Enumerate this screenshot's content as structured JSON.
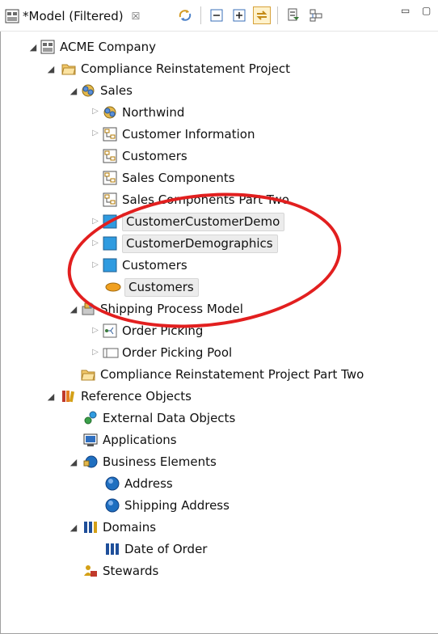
{
  "tab": {
    "title": "*Model (Filtered)",
    "close_glyph": "☒"
  },
  "toolbar": {
    "icons": [
      "sync-icon",
      "collapse-all-icon",
      "expand-all-icon",
      "link-with-editor-icon",
      "filter-icon",
      "layout-icon",
      "minimize-icon",
      "maximize-icon"
    ],
    "min_glyph": "▭",
    "max_glyph": "▢"
  },
  "tree": {
    "root": "ACME Company",
    "project1": "Compliance Reinstatement Project",
    "sales": "Sales",
    "northwind": "Northwind",
    "customer_information": "Customer Information",
    "customers_1": "Customers",
    "sales_components": "Sales Components",
    "sales_components_part_two": "Sales Components Part Two",
    "customer_customer_demo": "CustomerCustomerDemo",
    "customer_demographics": "CustomerDemographics",
    "customers_2": "Customers",
    "customers_3": "Customers",
    "shipping_process_model": "Shipping Process Model",
    "order_picking": "Order Picking",
    "order_picking_pool": "Order Picking Pool",
    "project2": "Compliance Reinstatement Project Part Two",
    "reference_objects": "Reference Objects",
    "external_data_objects": "External Data Objects",
    "applications": "Applications",
    "business_elements": "Business Elements",
    "address": "Address",
    "shipping_address": "Shipping Address",
    "domains": "Domains",
    "date_of_order": "Date of Order",
    "stewards": "Stewards"
  },
  "colors": {
    "highlight_oval": "#e21f1f",
    "selection_bg": "#ececec"
  }
}
